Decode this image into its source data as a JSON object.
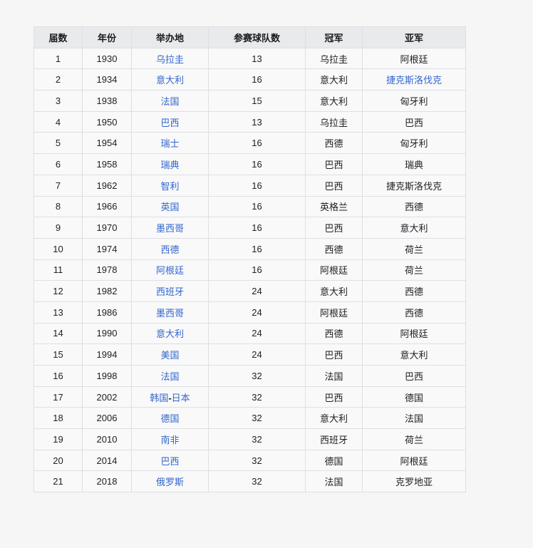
{
  "colors": {
    "page_background": "#f6f6f6",
    "header_background": "#e9eaec",
    "row_background": "#f9f9fa",
    "border": "#dcdfe3",
    "link": "#3366cc",
    "text": "#202122"
  },
  "table": {
    "columns": [
      {
        "key": "no",
        "label": "届数"
      },
      {
        "key": "year",
        "label": "年份"
      },
      {
        "key": "host",
        "label": "举办地"
      },
      {
        "key": "teams",
        "label": "参赛球队数"
      },
      {
        "key": "champion",
        "label": "冠军"
      },
      {
        "key": "runner_up",
        "label": "亚军"
      }
    ],
    "host_separator": "-",
    "rows": [
      {
        "no": "1",
        "year": "1930",
        "host": "乌拉圭",
        "teams": "13",
        "champion": "乌拉圭",
        "runner_up": "阿根廷",
        "runner_up_is_link": false
      },
      {
        "no": "2",
        "year": "1934",
        "host": "意大利",
        "teams": "16",
        "champion": "意大利",
        "runner_up": "捷克斯洛伐克",
        "runner_up_is_link": true
      },
      {
        "no": "3",
        "year": "1938",
        "host": "法国",
        "teams": "15",
        "champion": "意大利",
        "runner_up": "匈牙利",
        "runner_up_is_link": false
      },
      {
        "no": "4",
        "year": "1950",
        "host": "巴西",
        "teams": "13",
        "champion": "乌拉圭",
        "runner_up": "巴西",
        "runner_up_is_link": false
      },
      {
        "no": "5",
        "year": "1954",
        "host": "瑞士",
        "teams": "16",
        "champion": "西德",
        "runner_up": "匈牙利",
        "runner_up_is_link": false
      },
      {
        "no": "6",
        "year": "1958",
        "host": "瑞典",
        "teams": "16",
        "champion": "巴西",
        "runner_up": "瑞典",
        "runner_up_is_link": false
      },
      {
        "no": "7",
        "year": "1962",
        "host": "智利",
        "teams": "16",
        "champion": "巴西",
        "runner_up": "捷克斯洛伐克",
        "runner_up_is_link": false
      },
      {
        "no": "8",
        "year": "1966",
        "host": "英国",
        "teams": "16",
        "champion": "英格兰",
        "runner_up": "西德",
        "runner_up_is_link": false
      },
      {
        "no": "9",
        "year": "1970",
        "host": "墨西哥",
        "teams": "16",
        "champion": "巴西",
        "runner_up": "意大利",
        "runner_up_is_link": false
      },
      {
        "no": "10",
        "year": "1974",
        "host": "西德",
        "teams": "16",
        "champion": "西德",
        "runner_up": "荷兰",
        "runner_up_is_link": false
      },
      {
        "no": "11",
        "year": "1978",
        "host": "阿根廷",
        "teams": "16",
        "champion": "阿根廷",
        "runner_up": "荷兰",
        "runner_up_is_link": false
      },
      {
        "no": "12",
        "year": "1982",
        "host": "西班牙",
        "teams": "24",
        "champion": "意大利",
        "runner_up": "西德",
        "runner_up_is_link": false
      },
      {
        "no": "13",
        "year": "1986",
        "host": "墨西哥",
        "teams": "24",
        "champion": "阿根廷",
        "runner_up": "西德",
        "runner_up_is_link": false
      },
      {
        "no": "14",
        "year": "1990",
        "host": "意大利",
        "teams": "24",
        "champion": "西德",
        "runner_up": "阿根廷",
        "runner_up_is_link": false
      },
      {
        "no": "15",
        "year": "1994",
        "host": "美国",
        "teams": "24",
        "champion": "巴西",
        "runner_up": "意大利",
        "runner_up_is_link": false
      },
      {
        "no": "16",
        "year": "1998",
        "host": "法国",
        "teams": "32",
        "champion": "法国",
        "runner_up": "巴西",
        "runner_up_is_link": false
      },
      {
        "no": "17",
        "year": "2002",
        "host": "韩国-日本",
        "teams": "32",
        "champion": "巴西",
        "runner_up": "德国",
        "runner_up_is_link": false
      },
      {
        "no": "18",
        "year": "2006",
        "host": "德国",
        "teams": "32",
        "champion": "意大利",
        "runner_up": "法国",
        "runner_up_is_link": false
      },
      {
        "no": "19",
        "year": "2010",
        "host": "南非",
        "teams": "32",
        "champion": "西班牙",
        "runner_up": "荷兰",
        "runner_up_is_link": false
      },
      {
        "no": "20",
        "year": "2014",
        "host": "巴西",
        "teams": "32",
        "champion": "德国",
        "runner_up": "阿根廷",
        "runner_up_is_link": false
      },
      {
        "no": "21",
        "year": "2018",
        "host": "俄罗斯",
        "teams": "32",
        "champion": "法国",
        "runner_up": "克罗地亚",
        "runner_up_is_link": false
      }
    ]
  }
}
